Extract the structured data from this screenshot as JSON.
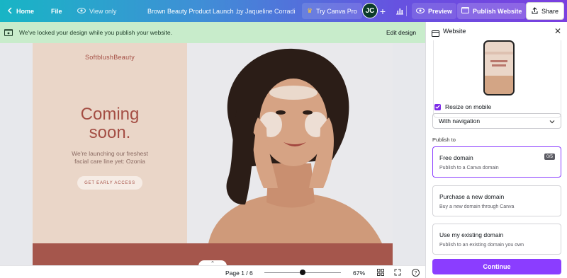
{
  "topbar": {
    "home_label": "Home",
    "file_label": "File",
    "view_label": "View only",
    "doc_title": "Brown Beauty Product Launch ...",
    "author": "by Jaqueline Corradi",
    "try_pro_label": "Try Canva Pro",
    "avatar_initials": "JC",
    "preview_label": "Preview",
    "publish_label": "Publish Website",
    "share_label": "Share"
  },
  "banner": {
    "message": "We've locked your design while you publish your website.",
    "edit_label": "Edit design"
  },
  "design": {
    "brand": "SoftblushBeauty",
    "headline_line1": "Coming",
    "headline_line2": "soon.",
    "sub_line1": "We're launching our freshest",
    "sub_line2": "facial care line yet: Ozonia",
    "cta_label": "GET EARLY ACCESS",
    "accent_color": "#a44e44",
    "panel_color": "#ead6c8"
  },
  "bottombar": {
    "page_label": "Page 1 / 6",
    "zoom_label": "67%",
    "zoom_level": 0.5
  },
  "panel": {
    "title": "Website",
    "resize_label": "Resize on mobile",
    "resize_checked": true,
    "nav_select_value": "With navigation",
    "publish_to_label": "Publish to",
    "options": [
      {
        "title": "Free domain",
        "subtitle": "Publish to a Canva domain",
        "badge": "0/5",
        "selected": true
      },
      {
        "title": "Purchase a new domain",
        "subtitle": "Buy a new domain through Canva",
        "selected": false
      },
      {
        "title": "Use my existing domain",
        "subtitle": "Publish to an existing domain you own",
        "selected": false
      }
    ],
    "continue_label": "Continue",
    "brand_color": "#8b3dff"
  }
}
